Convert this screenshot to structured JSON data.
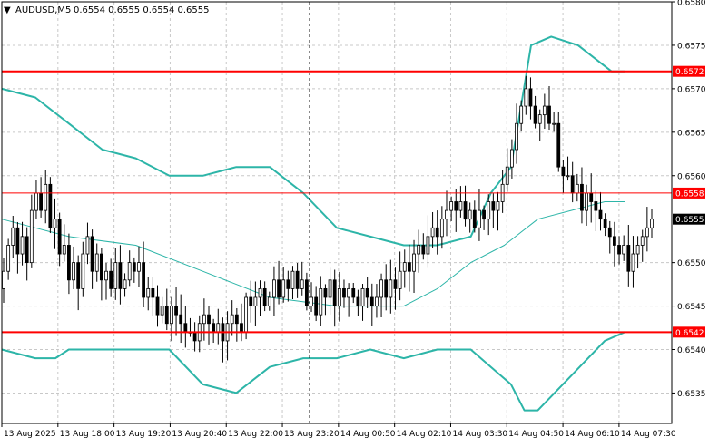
{
  "header": {
    "arrow": "▼",
    "symbol_tf": "AUDUSD,M5",
    "ohlc": "0.6554 0.6555 0.6554 0.6555"
  },
  "colors": {
    "background": "#ffffff",
    "grid": "#c8c8c8",
    "candle": "#000000",
    "bands": "#2db5a8",
    "ma": "#2db5a8",
    "level_line": "#ff0000",
    "level_label_bg": "#ff0000",
    "level_label_text": "#ffffff",
    "price_label_bg": "#000000",
    "price_label_text": "#ffffff",
    "crosshair": "#000000"
  },
  "chart_data": {
    "type": "candlestick",
    "symbol": "AUDUSD",
    "timeframe": "M5",
    "ylim": [
      0.65315,
      0.658
    ],
    "y_ticks": [
      "0.6580",
      "0.6575",
      "0.6570",
      "0.6565",
      "0.6560",
      "0.6550",
      "0.6545",
      "0.6540",
      "0.6535"
    ],
    "x_ticks": [
      "13 Aug 2025",
      "13 Aug 18:00",
      "13 Aug 19:20",
      "13 Aug 20:40",
      "13 Aug 22:00",
      "13 Aug 23:20",
      "14 Aug 00:50",
      "14 Aug 02:10",
      "14 Aug 03:30",
      "14 Aug 04:50",
      "14 Aug 06:10",
      "14 Aug 07:30"
    ],
    "grid": true,
    "current_price": "0.6555",
    "levels": [
      {
        "label": "0.6572",
        "value": 0.6572,
        "style": "thick"
      },
      {
        "label": "0.6558",
        "value": 0.6558,
        "style": "thin"
      },
      {
        "label": "0.6542",
        "value": 0.6542,
        "style": "thick"
      }
    ],
    "close": [
      0.6549,
      0.6552,
      0.6554,
      0.6551,
      0.6553,
      0.655,
      0.6556,
      0.6558,
      0.6556,
      0.6559,
      0.6554,
      0.6555,
      0.6551,
      0.6552,
      0.6548,
      0.655,
      0.6547,
      0.6551,
      0.6553,
      0.6549,
      0.6551,
      0.6548,
      0.6549,
      0.6547,
      0.655,
      0.6547,
      0.6548,
      0.655,
      0.6549,
      0.655,
      0.6546,
      0.6547,
      0.6546,
      0.6544,
      0.6545,
      0.6543,
      0.6545,
      0.6544,
      0.6543,
      0.6542,
      0.6542,
      0.6541,
      0.6543,
      0.6544,
      0.6543,
      0.6542,
      0.6543,
      0.6541,
      0.6543,
      0.6544,
      0.6543,
      0.6542,
      0.6546,
      0.6545,
      0.6546,
      0.6547,
      0.6545,
      0.6546,
      0.6548,
      0.6546,
      0.6548,
      0.6547,
      0.6549,
      0.6547,
      0.6548,
      0.6545,
      0.6546,
      0.6544,
      0.6547,
      0.6546,
      0.6548,
      0.6545,
      0.6547,
      0.6546,
      0.6547,
      0.6546,
      0.6545,
      0.6547,
      0.6546,
      0.6545,
      0.6546,
      0.6548,
      0.6546,
      0.6548,
      0.6547,
      0.6549,
      0.655,
      0.6549,
      0.6551,
      0.6552,
      0.6551,
      0.6553,
      0.6554,
      0.6553,
      0.6555,
      0.6556,
      0.6557,
      0.6556,
      0.6557,
      0.6555,
      0.6556,
      0.6554,
      0.6556,
      0.6555,
      0.6557,
      0.6556,
      0.6557,
      0.6559,
      0.6561,
      0.6563,
      0.6566,
      0.6568,
      0.657,
      0.6568,
      0.6566,
      0.6567,
      0.6568,
      0.6566,
      0.6566,
      0.6561,
      0.656,
      0.656,
      0.6558,
      0.6559,
      0.6556,
      0.6558,
      0.6557,
      0.6556,
      0.6555,
      0.6554,
      0.6553,
      0.6552,
      0.6551,
      0.6552,
      0.6549,
      0.6551,
      0.6552,
      0.6553,
      0.6554,
      0.6555
    ],
    "upper_band": [
      [
        0.0,
        0.657
      ],
      [
        0.05,
        0.6569
      ],
      [
        0.1,
        0.6566
      ],
      [
        0.15,
        0.6563
      ],
      [
        0.2,
        0.6562
      ],
      [
        0.25,
        0.656
      ],
      [
        0.3,
        0.656
      ],
      [
        0.35,
        0.6561
      ],
      [
        0.4,
        0.6561
      ],
      [
        0.45,
        0.6558
      ],
      [
        0.5,
        0.6554
      ],
      [
        0.55,
        0.6553
      ],
      [
        0.6,
        0.6552
      ],
      [
        0.65,
        0.6552
      ],
      [
        0.7,
        0.6553
      ],
      [
        0.73,
        0.6558
      ],
      [
        0.76,
        0.6561
      ],
      [
        0.79,
        0.6575
      ],
      [
        0.82,
        0.6576
      ],
      [
        0.86,
        0.6575
      ],
      [
        0.91,
        0.6572
      ],
      [
        0.93,
        0.6572
      ]
    ],
    "middle_band": [
      [
        0.0,
        0.6555
      ],
      [
        0.05,
        0.6554
      ],
      [
        0.1,
        0.6553
      ],
      [
        0.2,
        0.6552
      ],
      [
        0.3,
        0.6549
      ],
      [
        0.4,
        0.6546
      ],
      [
        0.5,
        0.6545
      ],
      [
        0.6,
        0.6545
      ],
      [
        0.65,
        0.6547
      ],
      [
        0.7,
        0.655
      ],
      [
        0.75,
        0.6552
      ],
      [
        0.8,
        0.6555
      ],
      [
        0.85,
        0.6556
      ],
      [
        0.9,
        0.6557
      ],
      [
        0.93,
        0.6557
      ]
    ],
    "lower_band": [
      [
        0.0,
        0.654
      ],
      [
        0.05,
        0.6539
      ],
      [
        0.08,
        0.6539
      ],
      [
        0.1,
        0.654
      ],
      [
        0.15,
        0.654
      ],
      [
        0.2,
        0.654
      ],
      [
        0.25,
        0.654
      ],
      [
        0.3,
        0.6536
      ],
      [
        0.35,
        0.6535
      ],
      [
        0.4,
        0.6538
      ],
      [
        0.45,
        0.6539
      ],
      [
        0.5,
        0.6539
      ],
      [
        0.55,
        0.654
      ],
      [
        0.6,
        0.6539
      ],
      [
        0.65,
        0.654
      ],
      [
        0.7,
        0.654
      ],
      [
        0.73,
        0.6538
      ],
      [
        0.76,
        0.6536
      ],
      [
        0.78,
        0.6533
      ],
      [
        0.8,
        0.6533
      ],
      [
        0.85,
        0.6537
      ],
      [
        0.9,
        0.6541
      ],
      [
        0.93,
        0.6542
      ]
    ]
  }
}
